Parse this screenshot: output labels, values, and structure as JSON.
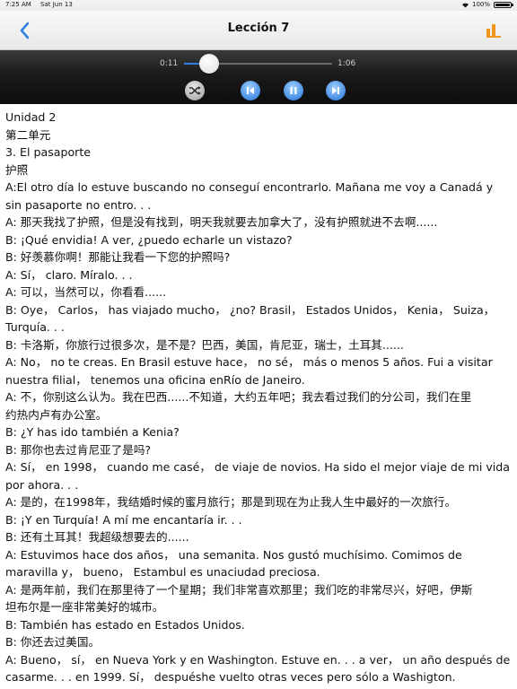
{
  "status_bar": {
    "time": "7:25 AM",
    "date": "Sat Jun 13",
    "battery": "100%"
  },
  "nav": {
    "title": "Lección 7"
  },
  "player": {
    "current_time": "0:11",
    "total_time": "1:06",
    "progress": 0.17
  },
  "lines": [
    "Unidad 2",
    "第二单元",
    "3.  El pasaporte",
    "护照",
    "A:El otro día lo estuve buscando no conseguí encontrarlo.  Mañana me voy a Canadá y",
    "sin pasaporte no entro. . .",
    "A: 那天我找了护照，但是没有找到，明天我就要去加拿大了，没有护照就进不去啊......",
    "B: ¡Qué envidia!  A ver, ¿puedo echarle un vistazo?",
    "B: 好羡慕你啊！那能让我看一下您的护照吗?",
    "A: Sí， claro.  Míralo. . .",
    "A: 可以，当然可以，你看看......",
    "B: Oye， Carlos， has viajado mucho， ¿no?  Brasil， Estados Unidos， Kenia， Suiza，",
    "Turquía. . .",
    "B: 卡洛斯，你旅行过很多次，是不是？巴西，美国，肯尼亚，瑞士，土耳其......",
    "A: No， no te creas.  En Brasil estuve hace， no sé， más o menos 5 años.  Fui a visitar",
    "nuestra filial， tenemos una oficina enRío de Janeiro.",
    "A: 不，你别这么认为。我在巴西......不知道，大约五年吧；我去看过我们的分公司，我们在里",
    "约热内卢有办公室。",
    "B: ¿Y has ido también a Kenia?",
    "B: 那你也去过肯尼亚了是吗?",
    "A: Sí， en 1998， cuando me casé， de viaje de novios.  Ha sido el mejor viaje de mi vida",
    "por ahora. . .",
    "A: 是的，在1998年，我结婚时候的蜜月旅行；那是到现在为止我人生中最好的一次旅行。",
    "B: ¡Y en Turquía!  A mí me encantaría ir. . .",
    "B: 还有土耳其！我超级想要去的......",
    "A: Estuvimos hace dos años， una semanita.  Nos gustó muchísimo.  Comimos de",
    "maravilla y， bueno， Estambul es unaciudad preciosa.",
    "A: 是两年前，我们在那里待了一个星期；我们非常喜欢那里；我们吃的非常尽兴，好吧，伊斯",
    "坦布尔是一座非常美好的城市。",
    "B: También has estado en Estados Unidos.",
    "B: 你还去过美国。",
    "A: Bueno， sí， en Nueva York y en Washington.  Estuve en. . .  a ver， un año después de",
    "casarme. . .  en 1999.  Sí， despuéshe vuelto otras veces pero sólo a Washigton."
  ]
}
